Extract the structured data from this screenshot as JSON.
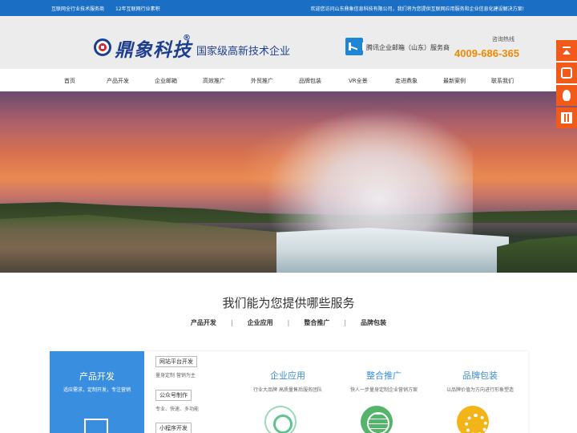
{
  "topbar": {
    "left1": "互联网全行业技术服务商",
    "left2": "12年互联网行业素积",
    "right": "欢迎您访问山东鼎象信息科技有限公司，我们将为您提供互联网应用服务和企业信息化建设解决方案!"
  },
  "header": {
    "brand": "鼎象科技",
    "reg": "®",
    "tagline": "国家级高新技术企业",
    "tencent_text": "腾讯企业邮箱（山东）服务商",
    "hotline_label": "咨询热线",
    "hotline_number": "4009-686-365"
  },
  "nav": {
    "items": [
      "首页",
      "产品开发",
      "企业邮箱",
      "高效推广",
      "外贸推广",
      "品牌包装",
      "VR全景",
      "走进鼎象",
      "最新案例",
      "联系我们"
    ]
  },
  "side_buttons": [
    "back-to-top-icon",
    "phone-icon",
    "qq-icon",
    "qrcode-icon"
  ],
  "services": {
    "title": "我们能为您提供哪些服务",
    "tabs": [
      "产品开发",
      "企业应用",
      "整合推广",
      "品牌包装"
    ],
    "separator": "|",
    "featured": {
      "title": "产品开发",
      "subtitle": "适应需求，定制开发，专注营销"
    },
    "sublist": [
      {
        "tag": "网站平台开发",
        "desc": "量身定制 营销为主"
      },
      {
        "tag": "公众号制作",
        "desc": "专业、快速、多功能"
      },
      {
        "tag": "小程序开发",
        "desc": ""
      }
    ],
    "columns": [
      {
        "title": "企业应用",
        "desc": "行业大品牌 高质量售后服务团队"
      },
      {
        "title": "整合推广",
        "desc": "快人一步量身定制企业营销方案"
      },
      {
        "title": "品牌包装",
        "desc": "以品牌价值为方向进行形象塑造"
      }
    ]
  },
  "colors": {
    "topbar": "#1a6fc4",
    "brand_blue": "#1e3f8f",
    "hotline_orange": "#f08a00",
    "side_orange": "#f25a1a",
    "service_blue": "#3a8ee0"
  }
}
